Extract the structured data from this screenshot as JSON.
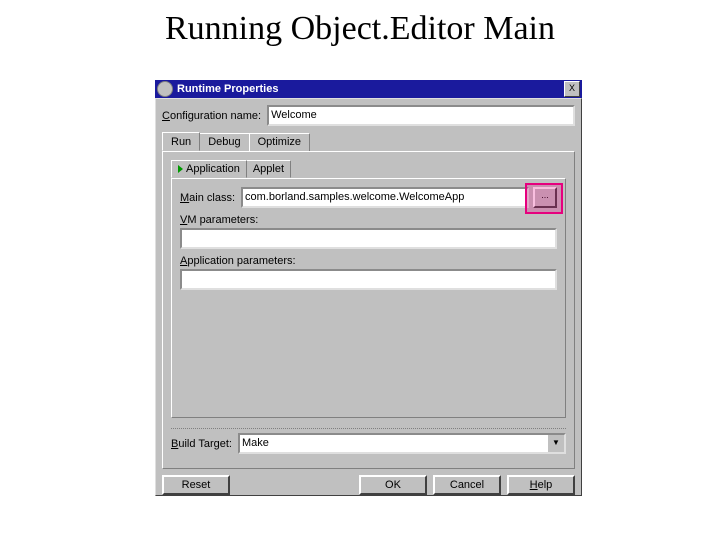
{
  "slide": {
    "title": "Running Object.Editor Main"
  },
  "window": {
    "title": "Runtime Properties",
    "close": "X"
  },
  "config": {
    "label": "Configuration name:",
    "value": "Welcome"
  },
  "tabs": {
    "run": "Run",
    "debug": "Debug",
    "optimize": "Optimize"
  },
  "inner_tabs": {
    "application": "Application",
    "applet": "Applet"
  },
  "fields": {
    "main_class_label": "Main class:",
    "main_class_value": "com.borland.samples.welcome.WelcomeApp",
    "browse": "...",
    "vm_label": "VM parameters:",
    "vm_value": "",
    "app_params_label": "Application parameters:",
    "app_params_value": ""
  },
  "build": {
    "label": "Build Target:",
    "value": "Make",
    "arrow": "▼"
  },
  "buttons": {
    "reset": "Reset",
    "ok": "OK",
    "cancel": "Cancel",
    "help": "Help"
  },
  "underlines": {
    "c": "C",
    "onfiguration": "onfiguration name:",
    "m": "M",
    "ain": "ain class:",
    "v": "V",
    "m_rest": "M parameters:",
    "a": "A",
    "pp_rest": "pplication parameters:",
    "b": "B",
    "uild_rest": "uild Target:",
    "h": "H",
    "elp_rest": "elp"
  }
}
